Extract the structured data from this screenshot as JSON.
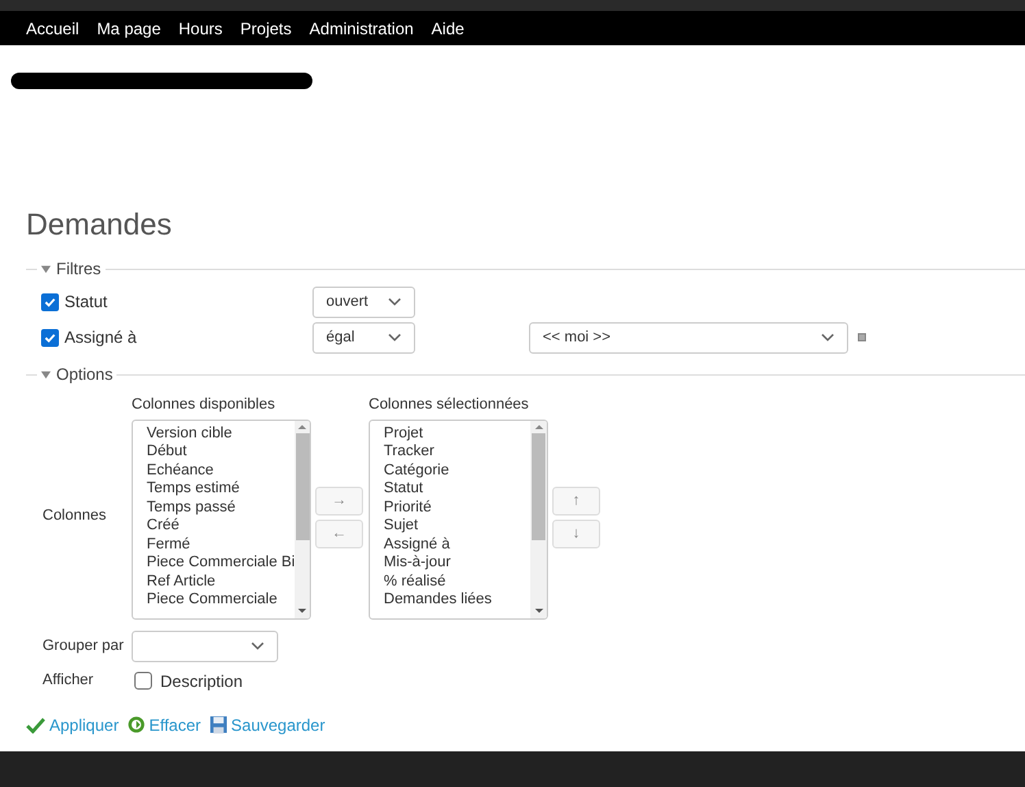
{
  "top_menu": [
    {
      "label": "Accueil"
    },
    {
      "label": "Ma page"
    },
    {
      "label": "Hours"
    },
    {
      "label": "Projets"
    },
    {
      "label": "Administration"
    },
    {
      "label": "Aide"
    }
  ],
  "title": "Demandes",
  "filters": {
    "legend": "Filtres",
    "expanded": true,
    "rows": [
      {
        "label": "Statut",
        "checked": true,
        "operator": "ouvert"
      },
      {
        "label": "Assigné à",
        "checked": true,
        "operator": "égal",
        "value": "<< moi >>"
      }
    ]
  },
  "options": {
    "legend": "Options",
    "expanded": true,
    "columns_label": "Colonnes",
    "available": {
      "title": "Colonnes disponibles",
      "items": [
        "Version cible",
        "Début",
        "Echéance",
        "Temps estimé",
        "Temps passé",
        "Créé",
        "Fermé",
        "Piece Commerciale Bi",
        "Ref Article",
        "Piece Commerciale"
      ]
    },
    "move_buttons": [
      "→",
      "←"
    ],
    "selected": {
      "title": "Colonnes sélectionnées",
      "items": [
        "Projet",
        "Tracker",
        "Catégorie",
        "Statut",
        "Priorité",
        "Sujet",
        "Assigné à",
        "Mis-à-jour",
        "% réalisé",
        "Demandes liées"
      ]
    },
    "order_buttons": [
      "↑",
      "↓"
    ],
    "group_label": "Grouper par",
    "show_label": "Afficher",
    "show_options": [
      {
        "label": "Description",
        "checked": false
      }
    ]
  },
  "actions": [
    {
      "kind": "apply",
      "label": "Appliquer"
    },
    {
      "kind": "clear",
      "label": "Effacer"
    },
    {
      "kind": "save",
      "label": "Sauvegarder"
    }
  ]
}
